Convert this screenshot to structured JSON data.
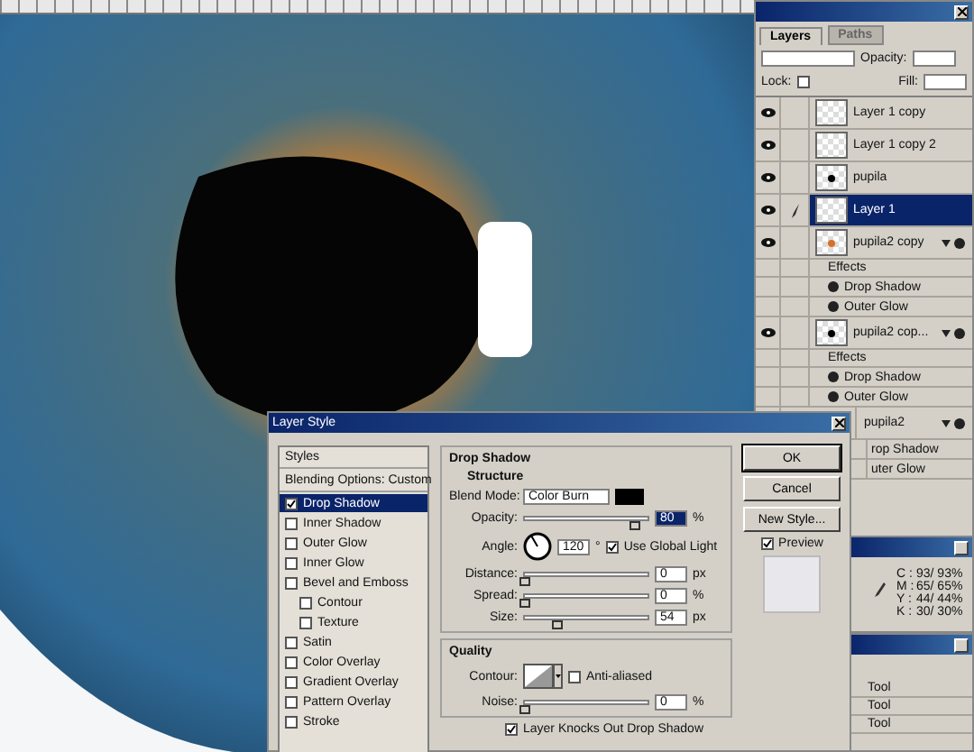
{
  "layers_panel": {
    "tabs": [
      {
        "label": "Layers",
        "selected": true
      },
      {
        "label": "Paths",
        "selected": false
      }
    ],
    "opacity_label": "Opacity:",
    "lock_label": "Lock:",
    "fill_label": "Fill:",
    "layers": [
      {
        "kind": "layer",
        "name": "Layer 1 copy",
        "selected": false,
        "visible": true,
        "linked": false
      },
      {
        "kind": "layer",
        "name": "Layer 1 copy 2",
        "selected": false,
        "visible": true,
        "linked": false
      },
      {
        "kind": "layer",
        "name": "pupila",
        "selected": false,
        "visible": true,
        "linked": false,
        "color": "#000000"
      },
      {
        "kind": "layer",
        "name": "Layer 1",
        "selected": true,
        "visible": true,
        "linked": true
      },
      {
        "kind": "layer",
        "name": "pupila2 copy",
        "selected": false,
        "visible": true,
        "linked": false,
        "color": "#d8702c",
        "effects": true
      },
      {
        "kind": "effects",
        "name": "Effects"
      },
      {
        "kind": "effect",
        "name": "Drop Shadow"
      },
      {
        "kind": "effect",
        "name": "Outer Glow"
      },
      {
        "kind": "layer",
        "name": "pupila2 cop...",
        "selected": false,
        "visible": true,
        "linked": false,
        "color": "#000000",
        "effects": true
      },
      {
        "kind": "effects",
        "name": "Effects"
      },
      {
        "kind": "effect",
        "name": "Drop Shadow"
      },
      {
        "kind": "effect",
        "name": "Outer Glow"
      },
      {
        "kind": "layer",
        "name": "pupila2",
        "selected": false,
        "effects": true,
        "covered": true
      },
      {
        "kind": "effect",
        "name": "rop Shadow",
        "covered": true
      },
      {
        "kind": "effect",
        "name": "uter Glow",
        "covered": true
      }
    ]
  },
  "info_panel": {
    "rows": [
      {
        "label": "C :",
        "value": "93/ 93%"
      },
      {
        "label": "M :",
        "value": "65/ 65%"
      },
      {
        "label": "Y :",
        "value": "44/ 44%"
      },
      {
        "label": "K :",
        "value": "30/ 30%"
      }
    ]
  },
  "tool_panel": {
    "rows": [
      "Tool",
      "Tool",
      "Tool"
    ]
  },
  "dialog": {
    "title": "Layer Style",
    "styles": [
      {
        "kind": "header",
        "label": "Styles"
      },
      {
        "kind": "header",
        "label": "Blending Options: Custom"
      },
      {
        "kind": "check",
        "label": "Drop Shadow",
        "checked": true,
        "selected": true
      },
      {
        "kind": "check",
        "label": "Inner Shadow",
        "checked": false,
        "selected": false
      },
      {
        "kind": "check",
        "label": "Outer Glow",
        "checked": false,
        "selected": false
      },
      {
        "kind": "check",
        "label": "Inner Glow",
        "checked": false,
        "selected": false
      },
      {
        "kind": "check",
        "label": "Bevel and Emboss",
        "checked": false,
        "selected": false,
        "children": [
          {
            "kind": "check",
            "label": "Contour",
            "checked": false,
            "selected": false
          },
          {
            "kind": "check",
            "label": "Texture",
            "checked": false,
            "selected": false
          }
        ]
      },
      {
        "kind": "check",
        "label": "Satin",
        "checked": false,
        "selected": false
      },
      {
        "kind": "check",
        "label": "Color Overlay",
        "checked": false,
        "selected": false
      },
      {
        "kind": "check",
        "label": "Gradient Overlay",
        "checked": false,
        "selected": false
      },
      {
        "kind": "check",
        "label": "Pattern Overlay",
        "checked": false,
        "selected": false
      },
      {
        "kind": "check",
        "label": "Stroke",
        "checked": false,
        "selected": false
      }
    ],
    "section_title": "Drop Shadow",
    "structure_title": "Structure",
    "blend_mode": {
      "label": "Blend Mode:",
      "value": "Color Burn"
    },
    "opacity": {
      "label": "Opacity:",
      "value": "80",
      "unit": "%",
      "level": 0.9
    },
    "angle": {
      "label": "Angle:",
      "value": "120",
      "unit": "°",
      "global_light": {
        "label": "Use Global Light",
        "checked": true
      }
    },
    "sliders": [
      {
        "label": "Distance:",
        "value": "0",
        "unit": "px",
        "level": 0
      },
      {
        "label": "Spread:",
        "value": "0",
        "unit": "%",
        "level": 0
      },
      {
        "label": "Size:",
        "value": "54",
        "unit": "px",
        "level": 0.27
      }
    ],
    "quality_title": "Quality",
    "contour_label": "Contour:",
    "anti_aliased": {
      "label": "Anti-aliased",
      "checked": false
    },
    "noise": {
      "label": "Noise:",
      "value": "0",
      "unit": "%",
      "level": 0
    },
    "knockout": {
      "label": "Layer Knocks Out Drop Shadow",
      "checked": true
    },
    "buttons": [
      {
        "label": "OK",
        "default": true
      },
      {
        "label": "Cancel",
        "default": false
      },
      {
        "label": "New Style...",
        "default": false
      }
    ],
    "preview": {
      "label": "Preview",
      "checked": true
    }
  }
}
